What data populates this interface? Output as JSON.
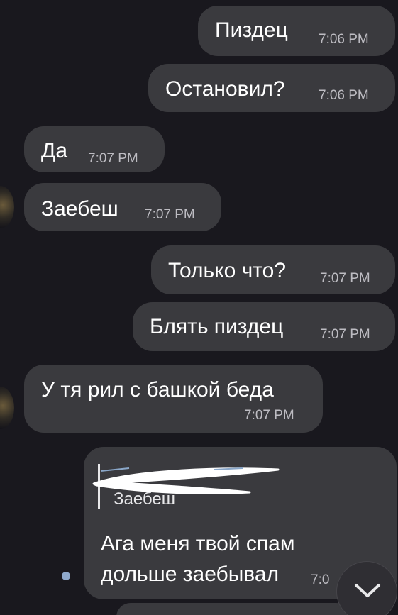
{
  "messages": [
    {
      "id": "m1",
      "direction": "outgoing",
      "text": "Пиздец",
      "time": "7:06 PM"
    },
    {
      "id": "m2",
      "direction": "outgoing",
      "text": "Остановил?",
      "time": "7:06 PM"
    },
    {
      "id": "m3",
      "direction": "incoming",
      "text": "Да",
      "time": "7:07 PM"
    },
    {
      "id": "m4",
      "direction": "incoming",
      "text": "Заебеш",
      "time": "7:07 PM"
    },
    {
      "id": "m5",
      "direction": "outgoing",
      "text": "Только что?",
      "time": "7:07 PM"
    },
    {
      "id": "m6",
      "direction": "outgoing",
      "text": "Блять пиздец",
      "time": "7:07 PM"
    },
    {
      "id": "m7",
      "direction": "incoming",
      "text": "У тя рил с башкой беда",
      "time": "7:07 PM"
    },
    {
      "id": "m8",
      "direction": "outgoing",
      "reply_to": {
        "text": "Заебеш"
      },
      "text_line1": "Ага меня твой спам",
      "text_line2": "дольше заебывал",
      "time": "7:0"
    }
  ],
  "icons": {
    "avatar": "contact-avatar",
    "scroll_down": "chevron-down-icon",
    "unread": "unread-dot"
  },
  "colors": {
    "background": "#19181e",
    "bubble": "#3a3a3e",
    "text": "#ffffff",
    "time": "#bdbcc2",
    "unread_dot": "#8fa9cc"
  }
}
